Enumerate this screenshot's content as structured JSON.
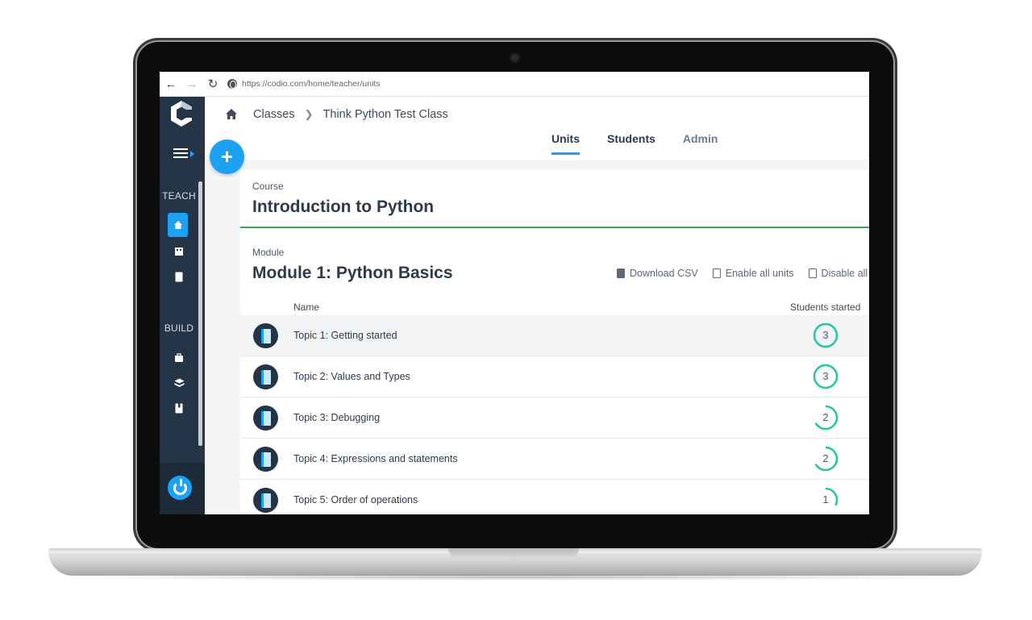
{
  "browser": {
    "url": "https://codio.com/home/teacher/units"
  },
  "sidebar": {
    "teach_label": "TEACH",
    "build_label": "BUILD"
  },
  "header": {
    "breadcrumb_root": "Classes",
    "breadcrumb_current": "Think Python Test Class",
    "tabs": [
      {
        "label": "Units",
        "active": true
      },
      {
        "label": "Students",
        "active": false
      },
      {
        "label": "Admin",
        "active": false
      }
    ],
    "add_label": "+"
  },
  "course": {
    "label": "Course",
    "title": "Introduction to Python"
  },
  "module": {
    "label": "Module",
    "title": "Module 1: Python Basics",
    "actions": {
      "download": "Download CSV",
      "enable": "Enable all units",
      "disable": "Disable all u"
    }
  },
  "table": {
    "col_name": "Name",
    "col_started": "Students started",
    "rows": [
      {
        "name": "Topic 1: Getting started",
        "started": "3",
        "fraction": 1.0
      },
      {
        "name": "Topic 2: Values and Types",
        "started": "3",
        "fraction": 1.0
      },
      {
        "name": "Topic 3: Debugging",
        "started": "2",
        "fraction": 0.67
      },
      {
        "name": "Topic 4: Expressions and statements",
        "started": "2",
        "fraction": 0.67
      },
      {
        "name": "Topic 5: Order of operations",
        "started": "1",
        "fraction": 0.33
      }
    ]
  },
  "colors": {
    "accent": "#1da1f2",
    "sidebar": "#253548",
    "progress": "#22c996",
    "course_underline": "#3aa657"
  }
}
